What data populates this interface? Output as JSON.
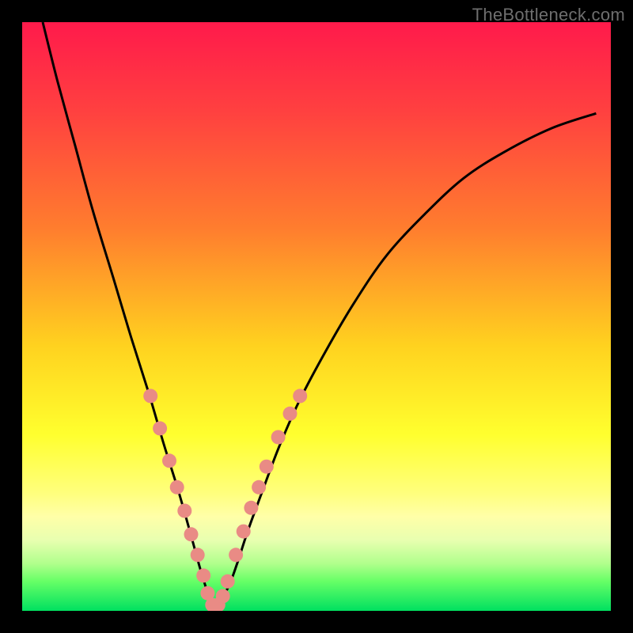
{
  "watermark": "TheBottleneck.com",
  "chart_data": {
    "type": "line",
    "title": "",
    "xlabel": "",
    "ylabel": "",
    "xlim": [
      0,
      100
    ],
    "ylim": [
      0,
      100
    ],
    "grid": false,
    "legend": false,
    "note": "Axes are unlabeled in the source image; x/y values are normalized to 0–100 by plot width/height. Curve and marker positions were read from pixel positions.",
    "series": [
      {
        "name": "bottleneck-curve",
        "x": [
          3.5,
          6.0,
          9.0,
          12.0,
          15.5,
          18.5,
          21.5,
          24.0,
          26.5,
          28.5,
          30.0,
          31.2,
          32.0,
          33.2,
          35.0,
          36.5,
          38.3,
          40.5,
          43.5,
          47.0,
          51.5,
          56.5,
          62.0,
          68.5,
          75.0,
          82.0,
          90.0,
          97.5
        ],
        "y": [
          100.0,
          90.0,
          79.0,
          68.0,
          56.5,
          46.5,
          37.0,
          28.5,
          20.5,
          13.5,
          8.0,
          4.0,
          1.2,
          1.2,
          4.0,
          8.0,
          13.5,
          19.5,
          27.5,
          35.5,
          44.0,
          52.5,
          60.5,
          67.5,
          73.5,
          78.0,
          82.0,
          84.5
        ]
      }
    ],
    "markers": {
      "name": "highlight-dots",
      "x": [
        21.8,
        23.4,
        25.0,
        26.3,
        27.6,
        28.7,
        29.8,
        30.8,
        31.5,
        32.3,
        33.3,
        34.1,
        34.9,
        36.3,
        37.6,
        38.9,
        40.2,
        41.5,
        43.5,
        45.5,
        47.2
      ],
      "y": [
        36.5,
        31.0,
        25.5,
        21.0,
        17.0,
        13.0,
        9.5,
        6.0,
        3.0,
        1.0,
        1.0,
        2.5,
        5.0,
        9.5,
        13.5,
        17.5,
        21.0,
        24.5,
        29.5,
        33.5,
        36.5
      ]
    }
  }
}
